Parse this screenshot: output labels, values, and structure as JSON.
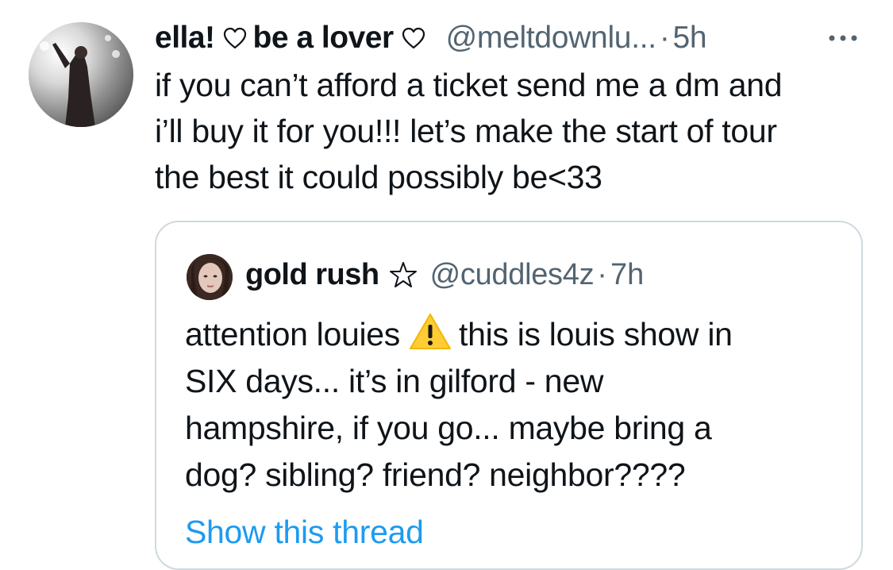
{
  "tweet": {
    "author": {
      "display_name_part1": "ella!",
      "display_name_part2": "be a lover",
      "handle": "@meltdownlu...",
      "separator": "·",
      "time": "5h",
      "name_icon": "heart-outline-icon"
    },
    "more_icon": "more-icon",
    "text_lines": [
      "if you can’t afford a ticket send me a dm and",
      "i’ll buy it for you!!! let’s make the start of tour",
      "the best it could possibly be<33"
    ]
  },
  "quote": {
    "author": {
      "display_name": "gold rush",
      "name_icon": "star-outline-icon",
      "handle": "@cuddles4z",
      "separator": "·",
      "time": "7h"
    },
    "text_line1_before_icon": "attention louies",
    "text_line1_after_icon": "this is louis show in",
    "inline_icon": "warning-icon",
    "text_lines_rest": [
      "SIX days... it’s in gilford - new",
      "hampshire, if you go... maybe bring a",
      "dog? sibling? friend? neighbor????"
    ],
    "show_thread_label": "Show this thread"
  },
  "colors": {
    "text": "#0f1419",
    "secondary": "#536471",
    "link": "#1d9bf0",
    "border": "#cfd9de",
    "warning": "#ffcc33"
  }
}
